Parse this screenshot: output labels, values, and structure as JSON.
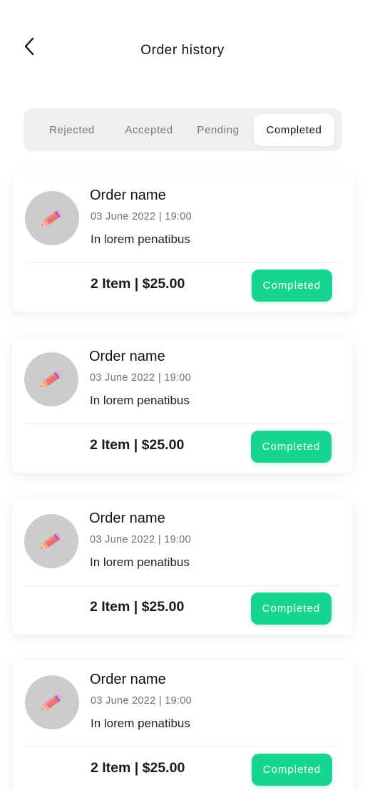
{
  "header": {
    "title": "Order history",
    "back_icon": "chevron-left-icon"
  },
  "tabs": [
    {
      "label": "Rejected",
      "active": false
    },
    {
      "label": "Accepted",
      "active": false
    },
    {
      "label": "Pending",
      "active": false
    },
    {
      "label": "Completed",
      "active": true
    }
  ],
  "orders": [
    {
      "name": "Order name",
      "date": "03 June 2022 | 19:00",
      "description": "In lorem penatibus",
      "total": "2 Item | $25.00",
      "status": "Completed",
      "icon": "pencil-icon"
    },
    {
      "name": "Order name",
      "date": "03 June 2022 | 19:00",
      "description": "In lorem penatibus",
      "total": "2 Item | $25.00",
      "status": "Completed",
      "icon": "pencil-icon"
    },
    {
      "name": "Order name",
      "date": "03 June 2022 | 19:00",
      "description": "In lorem penatibus",
      "total": "2 Item | $25.00",
      "status": "Completed",
      "icon": "pencil-icon"
    },
    {
      "name": "Order name",
      "date": "03 June 2022 | 19:00",
      "description": "In lorem penatibus",
      "total": "2 Item | $25.00",
      "status": "Completed",
      "icon": "pencil-icon"
    }
  ],
  "colors": {
    "accent": "#16d68f",
    "avatar_bg": "#cccccc",
    "tabs_bg": "#efefef"
  }
}
